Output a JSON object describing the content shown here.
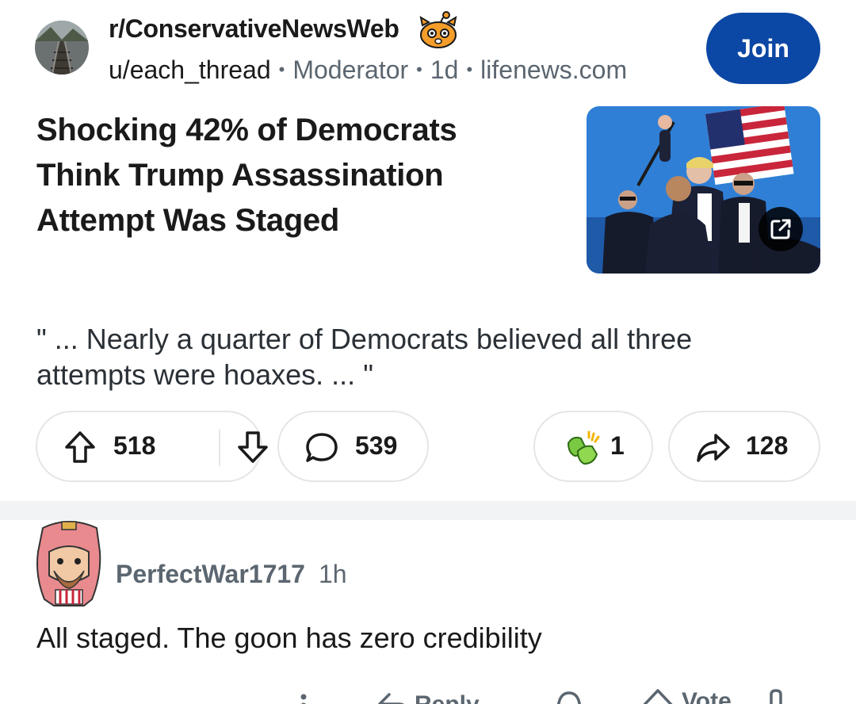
{
  "post": {
    "community": "r/ConservativeNewsWeb",
    "author": "u/each_thread",
    "role": "Moderator",
    "age": "1d",
    "domain": "lifenews.com",
    "join_label": "Join",
    "title": "Shocking 42% of Democrats Think Trump Assassination Attempt Was Staged",
    "body": "\" ... Nearly a quarter of Democrats believed all three attempts were hoaxes. ... \"",
    "upvotes": "518",
    "comments": "539",
    "awards": "1",
    "shares": "128"
  },
  "comment": {
    "author": "PerfectWar1717",
    "time": "1h",
    "text": "All staged. The goon has zero credibility",
    "reply_label": "Reply",
    "vote_label": "Vote"
  },
  "colors": {
    "join_bg": "#0b47a4",
    "muted_text": "#5b6670",
    "pill_border": "#e3e6e8",
    "band": "#f1f3f5"
  },
  "icons": {
    "upvote": "arrow-up-icon",
    "downvote": "arrow-down-icon",
    "comment": "speech-bubble-icon",
    "award": "award-hands-icon",
    "share": "share-arrow-icon",
    "external": "external-link-icon",
    "more": "more-vertical-icon",
    "reply": "reply-arrow-icon"
  }
}
